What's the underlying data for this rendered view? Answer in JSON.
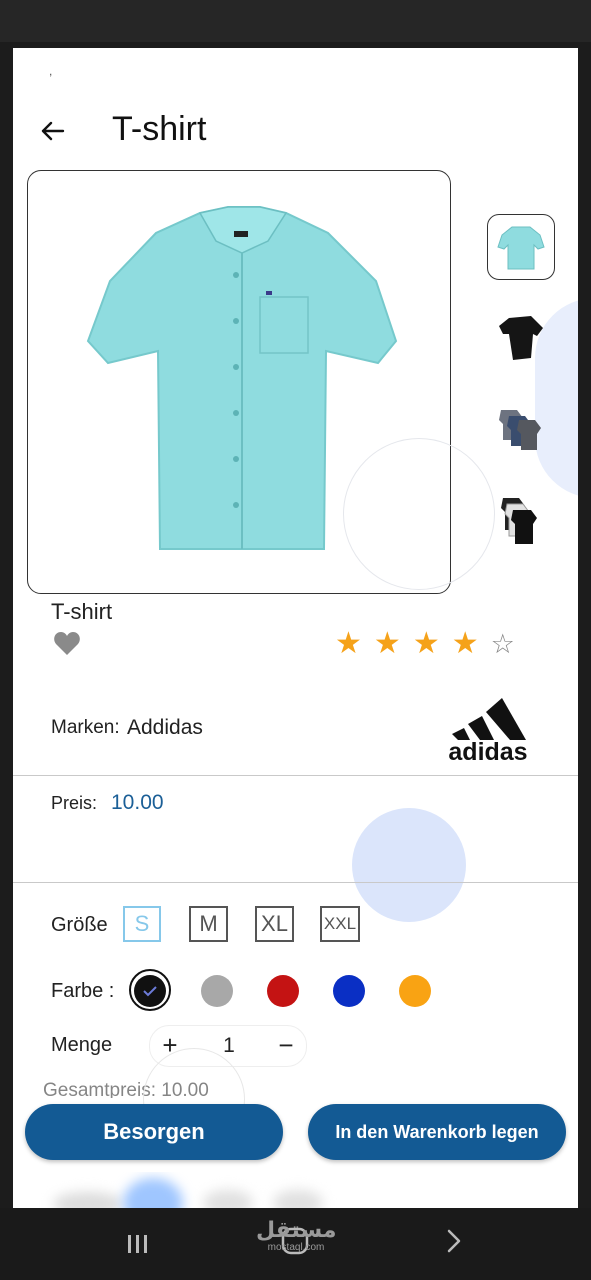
{
  "header": {
    "title": "T-shirt",
    "tick_mark": ","
  },
  "product": {
    "name": "T-shirt",
    "rating": 4,
    "rating_max": 5,
    "brand_label": "Marken:",
    "brand_value": "Addidas",
    "brand_logo_text": "adidas",
    "price_label": "Preis:",
    "price_value": "10.00"
  },
  "gallery": {
    "thumbnails": [
      "light-blue-shirt",
      "black-tshirt",
      "grey-tshirt-pack",
      "black-tshirt-pack"
    ],
    "selected_index": 0
  },
  "options": {
    "size_label": "Größe",
    "sizes": [
      "S",
      "M",
      "XL",
      "XXL"
    ],
    "selected_size": "S",
    "color_label": "Farbe :",
    "colors": [
      "#111111",
      "#a8a8a8",
      "#c41313",
      "#0a2fc4",
      "#f9a313"
    ],
    "selected_color_index": 0,
    "quantity_label": "Menge",
    "quantity": "1",
    "plus_symbol": "+",
    "minus_symbol": "−",
    "partial_row_text": "Gesamtpreis: 10.00"
  },
  "actions": {
    "buy_label": "Besorgen",
    "cart_label": "In den Warenkorb legen"
  },
  "system_nav": {
    "watermark_text": "مستقل",
    "watermark_sub": "mostaql.com"
  },
  "colors": {
    "primary_button": "#135a94",
    "price": "#1b5f97",
    "star": "#f5a21a",
    "selected_size": "#86c8ea"
  }
}
